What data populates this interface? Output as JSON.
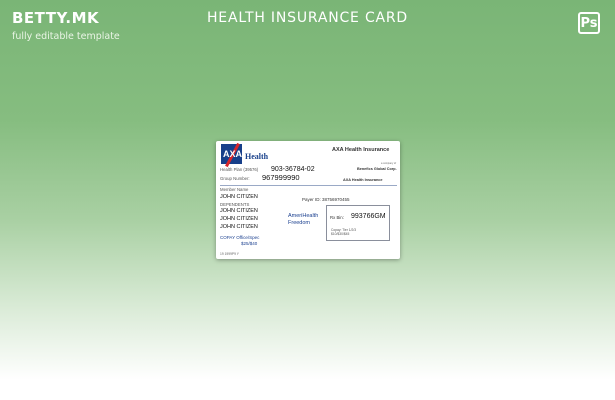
{
  "header": {
    "brand": "BETTY.MK",
    "tagline": "fully editable template",
    "title": "HEALTH INSURANCE CARD",
    "ps_icon": "Ps"
  },
  "card": {
    "logo_text": "AXA",
    "logo_word": "Health",
    "insurer_name": "AXA Health Insurance",
    "tiny_line": "a company of",
    "benefits": "Benefics Global Corp.",
    "insurer_name_small": "AXA Health Insurance",
    "health_plan_label": "Health Plan (39576)",
    "health_plan_value": "903-36784-02",
    "group_number_label": "Group Number:",
    "group_number_value": "967999990",
    "member_name_label": "Member Name",
    "member_name": "JOHN CITIZEN",
    "dependents_label": "DEPENDENTS",
    "dependents": [
      "JOHN CITIZEN",
      "JOHN CITIZEN",
      "JOHN CITIZEN"
    ],
    "payer_id": "Payer ID: 38756970455",
    "plan_name_1": "AmeriHealth",
    "plan_name_2": "Freedom",
    "rx_bin_label": "Rx Bin:",
    "rx_bin_value": "993766GM",
    "rx_copay_1": "Copay: Tier 1/2/3",
    "rx_copay_2": "$10/$30/$45",
    "copay_label": "COPAY Office/Spec",
    "copay_amounts": "$25/$40",
    "serial": "19 1999P9 Y"
  },
  "colors": {
    "background_top": "#7ab576",
    "background_bottom": "#ffffff",
    "axa_blue": "#173f8a",
    "axa_red": "#d7262b"
  }
}
